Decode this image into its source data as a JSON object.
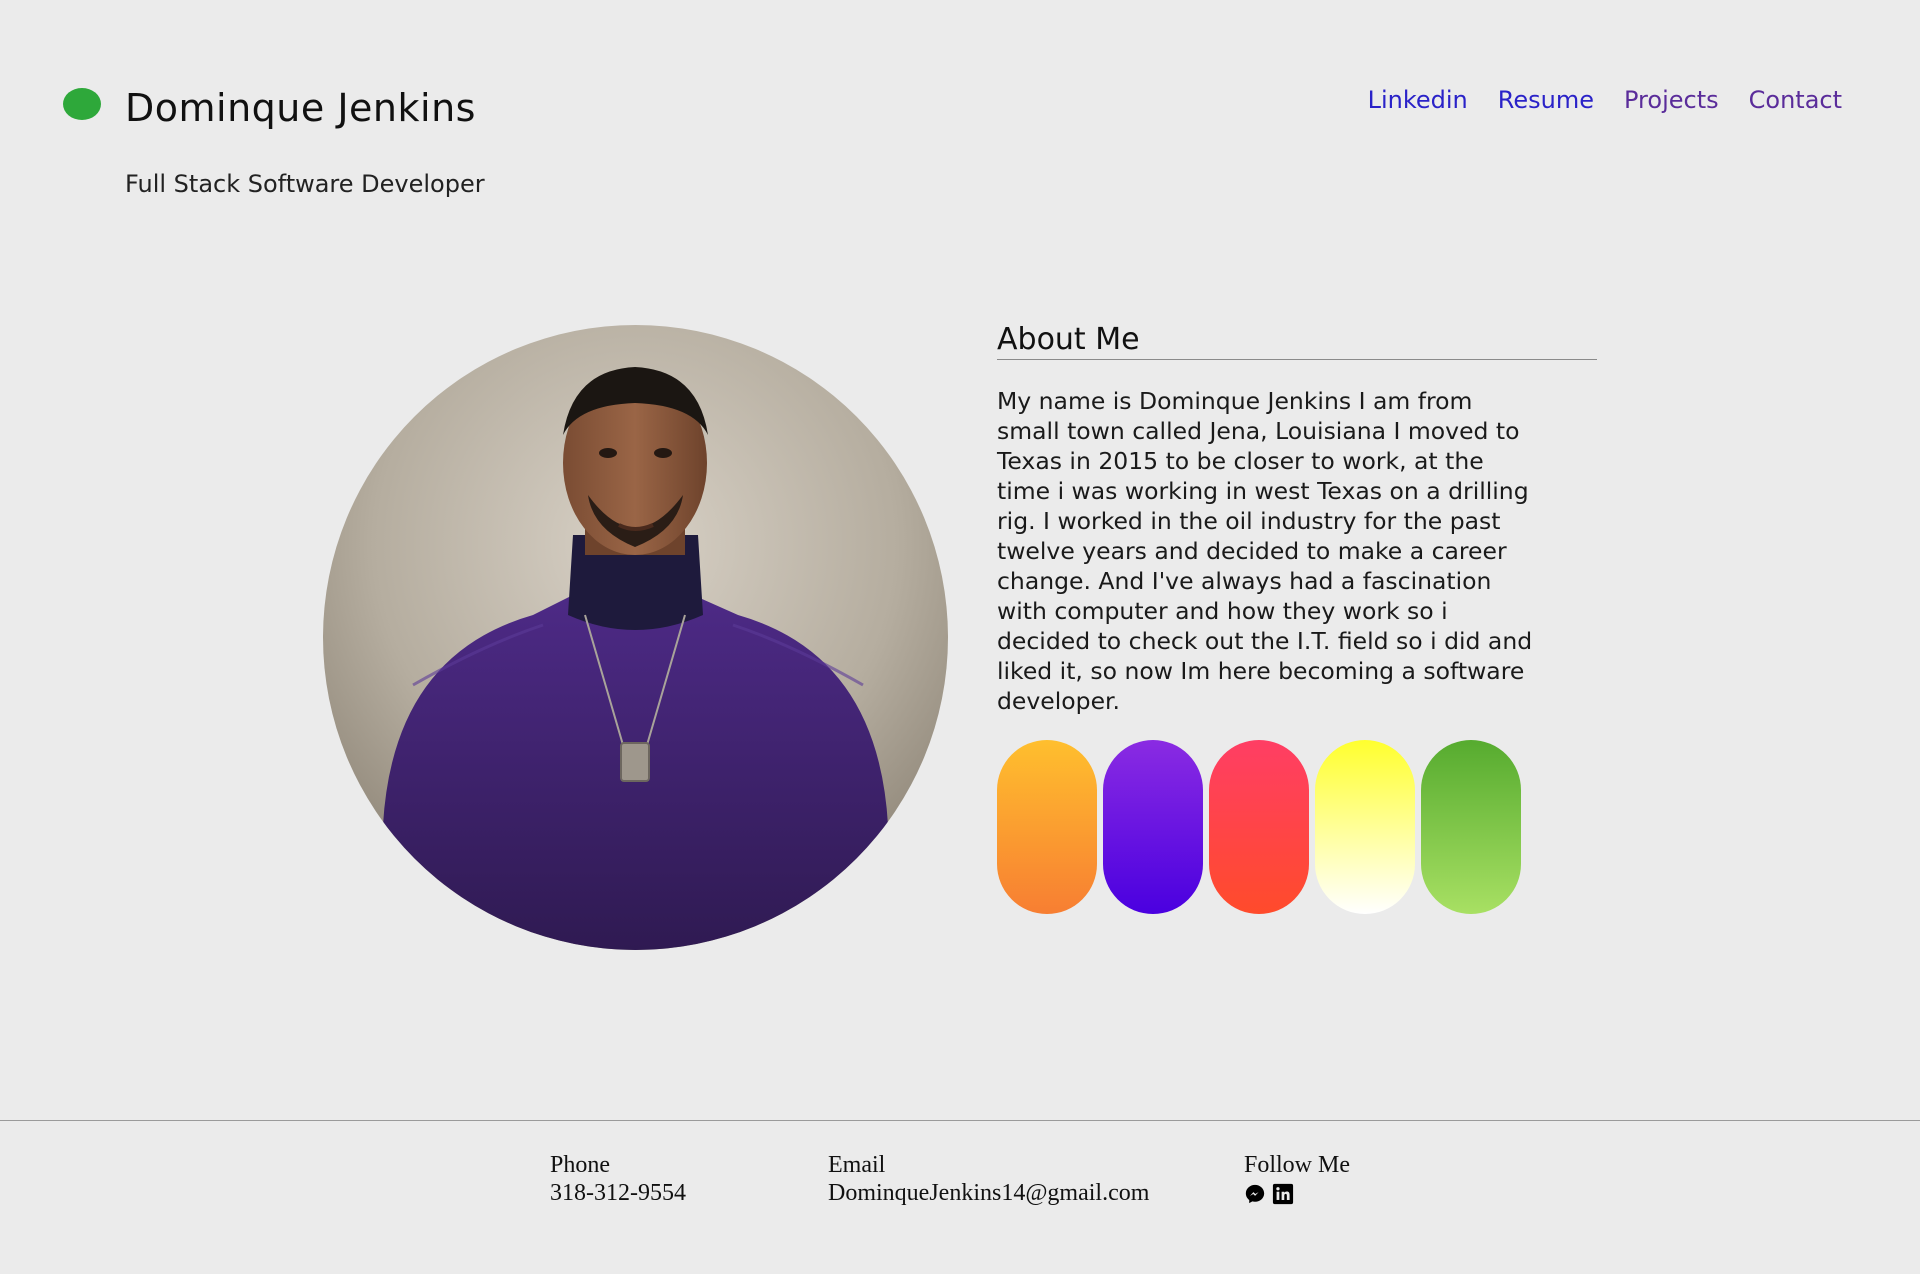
{
  "header": {
    "name": "Dominque Jenkins",
    "tagline": "Full Stack Software Developer",
    "status_color": "#2ea83a"
  },
  "nav": {
    "items": [
      {
        "label": "Linkedin",
        "color": "#2a22c8"
      },
      {
        "label": "Resume",
        "color": "#2a22c8"
      },
      {
        "label": "Projects",
        "color": "#5a2c9a"
      },
      {
        "label": "Contact",
        "color": "#5a2c9a"
      }
    ]
  },
  "about": {
    "title": "About Me",
    "text": "My name is Dominque Jenkins I am from small town called Jena, Louisiana I moved to Texas in 2015 to be closer to work, at the time i was working in west Texas on a drilling rig. I worked in the oil industry for the past twelve years and decided to make a career change. And I've always had a fascination with computer and how they work so i decided to check out the I.T. field so i did and liked it, so now Im here becoming a software developer."
  },
  "theme_swatches": [
    {
      "name": "orange",
      "top": "#ffbf2e",
      "bottom": "#f77e32"
    },
    {
      "name": "purple",
      "top": "#8a2be2",
      "bottom": "#4a00e0"
    },
    {
      "name": "red",
      "top": "#ff3e64",
      "bottom": "#ff4b2b"
    },
    {
      "name": "yellow",
      "top": "#ffff2e",
      "bottom": "#ffffff"
    },
    {
      "name": "green",
      "top": "#56ab2f",
      "bottom": "#a8e063"
    }
  ],
  "footer": {
    "phone_label": "Phone",
    "phone": "318-312-9554",
    "email_label": "Email",
    "email": "DominqueJenkins14@gmail.com",
    "follow_label": "Follow Me",
    "social_icons": [
      "messenger-icon",
      "linkedin-icon"
    ]
  }
}
